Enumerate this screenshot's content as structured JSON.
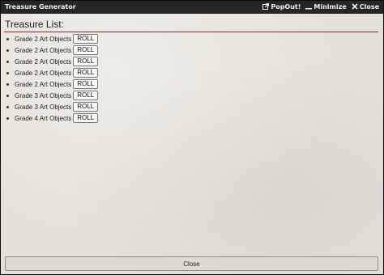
{
  "window": {
    "title": "Treasure Generator",
    "controls": {
      "popout": "PopOut!",
      "minimize": "Minimize",
      "close": "Close"
    },
    "icons": {
      "popout": "external-link-icon",
      "minimize": "minimize-icon",
      "close": "close-icon"
    }
  },
  "main": {
    "heading": "Treasure List:",
    "items": [
      {
        "label": "Grade 2 Art Objects",
        "button": "ROLL"
      },
      {
        "label": "Grade 2 Art Objects",
        "button": "ROLL"
      },
      {
        "label": "Grade 2 Art Objects",
        "button": "ROLL"
      },
      {
        "label": "Grade 2 Art Objects",
        "button": "ROLL"
      },
      {
        "label": "Grade 2 Art Objects",
        "button": "ROLL"
      },
      {
        "label": "Grade 3 Art Objects",
        "button": "ROLL"
      },
      {
        "label": "Grade 3 Art Objects",
        "button": "ROLL"
      },
      {
        "label": "Grade 4 Art Objects",
        "button": "ROLL"
      }
    ]
  },
  "footer": {
    "close_label": "Close"
  },
  "colors": {
    "titlebar": "#262626",
    "accent_rule": "#8a2a22",
    "background": "#e5e2da"
  }
}
